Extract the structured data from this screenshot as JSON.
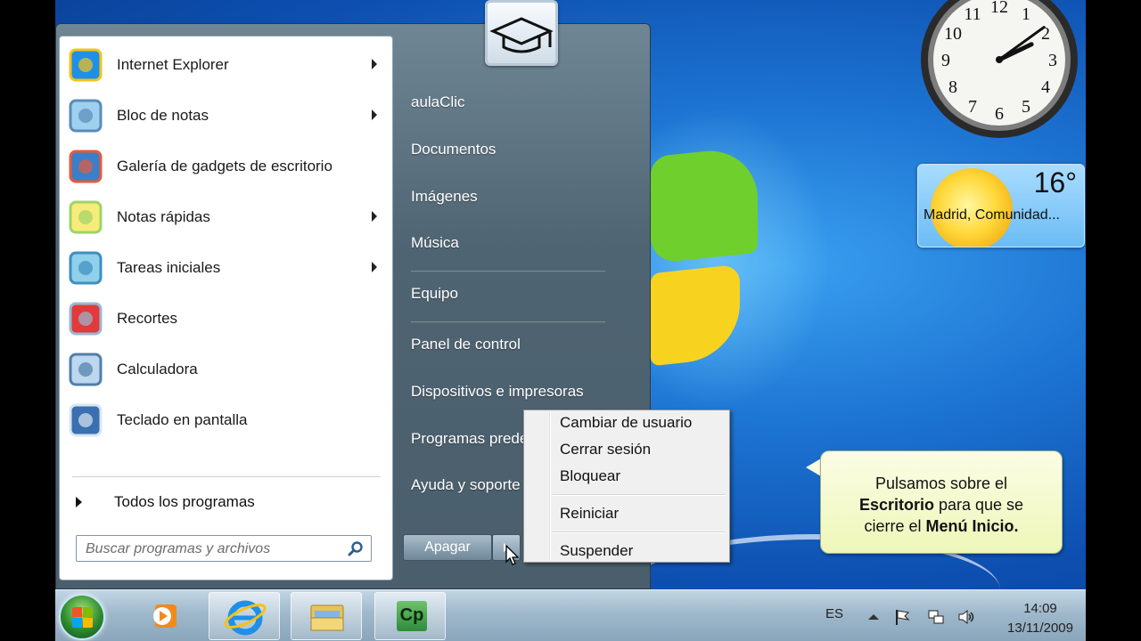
{
  "start_menu": {
    "programs": [
      {
        "label": "Internet Explorer",
        "arrow": true,
        "icon": "internet-explorer-icon"
      },
      {
        "label": "Bloc de notas",
        "arrow": true,
        "icon": "notepad-icon"
      },
      {
        "label": "Galería de gadgets de escritorio",
        "arrow": false,
        "icon": "gadgets-icon"
      },
      {
        "label": "Notas rápidas",
        "arrow": true,
        "icon": "sticky-notes-icon"
      },
      {
        "label": "Tareas iniciales",
        "arrow": true,
        "icon": "getting-started-icon"
      },
      {
        "label": "Recortes",
        "arrow": false,
        "icon": "snipping-tool-icon"
      },
      {
        "label": "Calculadora",
        "arrow": false,
        "icon": "calculator-icon"
      },
      {
        "label": "Teclado en pantalla",
        "arrow": false,
        "icon": "keyboard-icon"
      }
    ],
    "all_programs": "Todos los programas",
    "search_placeholder": "Buscar programas y archivos",
    "right_items": [
      "aulaClic",
      "Documentos",
      "Imágenes",
      "Música",
      "Equipo",
      "Panel de control",
      "Dispositivos e impresoras",
      "Programas predeterminados",
      "Ayuda y soporte técnico"
    ],
    "shutdown_label": "Apagar"
  },
  "shutdown_submenu": {
    "items": [
      "Cambiar de usuario",
      "Cerrar sesión",
      "Bloquear",
      "Reiniciar",
      "Suspender"
    ]
  },
  "callout": {
    "line1": "Pulsamos sobre el",
    "bold1": "Escritorio",
    "mid": " para que se",
    "line3_pre": "cierre el ",
    "bold2": "Menú Inicio."
  },
  "weather_gadget": {
    "temperature": "16°",
    "city": "Madrid, Comunidad..."
  },
  "clock_gadget": {
    "numerals": [
      "12",
      "1",
      "2",
      "3",
      "4",
      "5",
      "6",
      "7",
      "8",
      "9",
      "10",
      "11"
    ],
    "time": "14:09"
  },
  "taskbar": {
    "apps": [
      "media-player-icon",
      "internet-explorer-icon",
      "explorer-icon",
      "captivate-icon"
    ],
    "captivate_label": "Cp",
    "language": "ES",
    "time": "14:09",
    "date": "13/11/2009"
  }
}
